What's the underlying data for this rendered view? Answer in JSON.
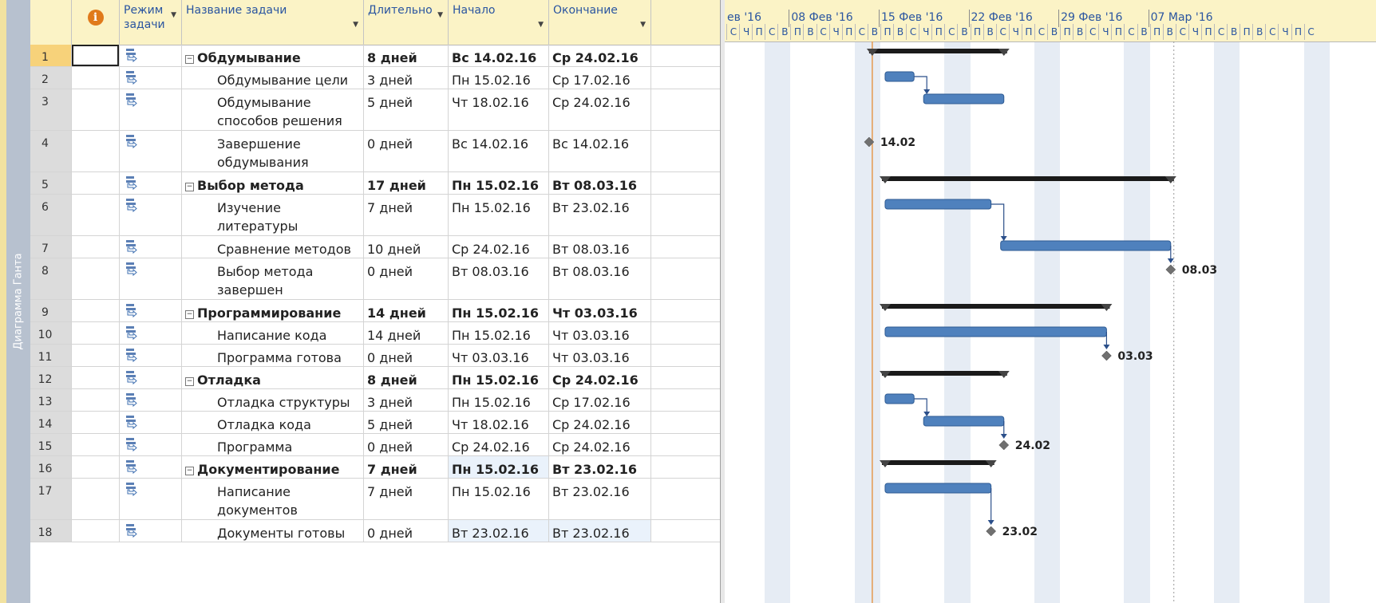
{
  "app": {
    "view_tab_label": "Диаграмма Ганта",
    "colors": {
      "bar": "#4f81bd",
      "summary": "#1a1a1a",
      "today": "#e59a4f",
      "link": "#2b4f8a",
      "milestone": "#707070"
    },
    "info_icon": "info-icon",
    "info_glyph": "i"
  },
  "columns": {
    "mode": "Режим задачи",
    "name": "Название задачи",
    "duration": "Длительно",
    "start": "Начало",
    "finish": "Окончание"
  },
  "timeline": {
    "weeks": [
      "ев '16",
      "08 Фев '16",
      "15 Фев '16",
      "22 Фев '16",
      "29 Фев '16",
      "07 Мар '16"
    ],
    "day_letters": [
      "С",
      "Ч",
      "П",
      "С",
      "В",
      "П",
      "В",
      "С",
      "Ч",
      "П",
      "С",
      "В",
      "П",
      "В",
      "С",
      "Ч",
      "П",
      "С",
      "В",
      "П",
      "В",
      "С",
      "Ч",
      "П",
      "С",
      "В",
      "П",
      "В",
      "С",
      "Ч",
      "П",
      "С",
      "В",
      "П",
      "В",
      "С",
      "Ч",
      "П",
      "С",
      "В",
      "П",
      "В",
      "С",
      "Ч",
      "П",
      "С"
    ]
  },
  "tasks": [
    {
      "id": "1",
      "name": "Обдумывание",
      "duration": "8 дней",
      "start": "Вс 14.02.16",
      "finish": "Ср 24.02.16",
      "summary": true
    },
    {
      "id": "2",
      "name": "Обдумывание цели",
      "duration": "3 дней",
      "start": "Пн 15.02.16",
      "finish": "Ср 17.02.16"
    },
    {
      "id": "3",
      "name": "Обдумывание способов решения",
      "duration": "5 дней",
      "start": "Чт 18.02.16",
      "finish": "Ср 24.02.16"
    },
    {
      "id": "4",
      "name": "Завершение обдумывания",
      "duration": "0 дней",
      "start": "Вс 14.02.16",
      "finish": "Вс 14.02.16",
      "milestone": "14.02"
    },
    {
      "id": "5",
      "name": "Выбор метода",
      "duration": "17 дней",
      "start": "Пн 15.02.16",
      "finish": "Вт 08.03.16",
      "summary": true
    },
    {
      "id": "6",
      "name": "Изучение литературы",
      "duration": "7 дней",
      "start": "Пн 15.02.16",
      "finish": "Вт 23.02.16"
    },
    {
      "id": "7",
      "name": "Сравнение методов",
      "duration": "10 дней",
      "start": "Ср 24.02.16",
      "finish": "Вт 08.03.16"
    },
    {
      "id": "8",
      "name": "Выбор метода завершен",
      "duration": "0 дней",
      "start": "Вт 08.03.16",
      "finish": "Вт 08.03.16",
      "milestone": "08.03"
    },
    {
      "id": "9",
      "name": "Программирование",
      "duration": "14 дней",
      "start": "Пн 15.02.16",
      "finish": "Чт 03.03.16",
      "summary": true
    },
    {
      "id": "10",
      "name": "Написание кода",
      "duration": "14 дней",
      "start": "Пн 15.02.16",
      "finish": "Чт 03.03.16"
    },
    {
      "id": "11",
      "name": "Программа готова",
      "duration": "0 дней",
      "start": "Чт 03.03.16",
      "finish": "Чт 03.03.16",
      "milestone": "03.03"
    },
    {
      "id": "12",
      "name": "Отладка",
      "duration": "8 дней",
      "start": "Пн 15.02.16",
      "finish": "Ср 24.02.16",
      "summary": true
    },
    {
      "id": "13",
      "name": "Отладка структуры",
      "duration": "3 дней",
      "start": "Пн 15.02.16",
      "finish": "Ср 17.02.16"
    },
    {
      "id": "14",
      "name": "Отладка кода",
      "duration": "5 дней",
      "start": "Чт 18.02.16",
      "finish": "Ср 24.02.16"
    },
    {
      "id": "15",
      "name": "Программа отлажена",
      "duration": "0 дней",
      "start": "Ср 24.02.16",
      "finish": "Ср 24.02.16",
      "milestone": "24.02"
    },
    {
      "id": "16",
      "name": "Документирование",
      "duration": "7 дней",
      "start": "Пн 15.02.16",
      "finish": "Вт 23.02.16",
      "summary": true
    },
    {
      "id": "17",
      "name": "Написание документов",
      "duration": "7 дней",
      "start": "Пн 15.02.16",
      "finish": "Вт 23.02.16"
    },
    {
      "id": "18",
      "name": "Документы готовы",
      "duration": "0 дней",
      "start": "Вт 23.02.16",
      "finish": "Вт 23.02.16",
      "milestone": "23.02"
    }
  ]
}
